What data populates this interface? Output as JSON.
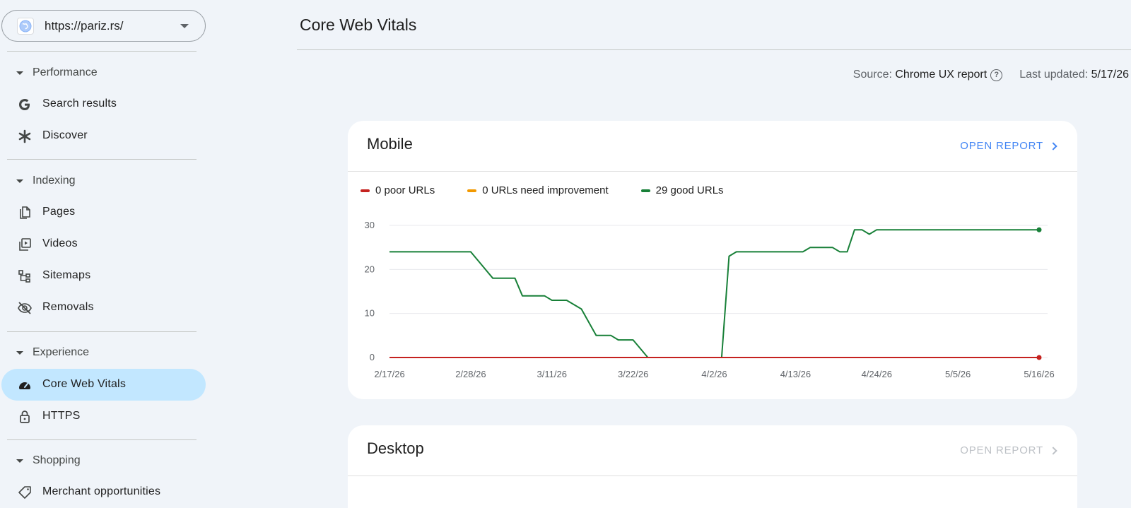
{
  "property": {
    "url": "https://pariz.rs/"
  },
  "sidebar": {
    "sections": [
      {
        "label": "Performance",
        "items": [
          {
            "label": "Search results",
            "icon": "google-g-icon"
          },
          {
            "label": "Discover",
            "icon": "asterisk-icon"
          }
        ]
      },
      {
        "label": "Indexing",
        "items": [
          {
            "label": "Pages",
            "icon": "pages-icon"
          },
          {
            "label": "Videos",
            "icon": "videos-icon"
          },
          {
            "label": "Sitemaps",
            "icon": "sitemaps-icon"
          },
          {
            "label": "Removals",
            "icon": "eye-off-icon"
          }
        ]
      },
      {
        "label": "Experience",
        "items": [
          {
            "label": "Core Web Vitals",
            "icon": "speedometer-icon",
            "active": true
          },
          {
            "label": "HTTPS",
            "icon": "lock-icon"
          }
        ]
      },
      {
        "label": "Shopping",
        "items": [
          {
            "label": "Merchant opportunities",
            "icon": "tag-icon"
          }
        ]
      }
    ]
  },
  "header": {
    "title": "Core Web Vitals"
  },
  "meta": {
    "source_label": "Source:",
    "source_value": "Chrome UX report",
    "updated_label": "Last updated:",
    "updated_value": "5/17/26"
  },
  "mobile_card": {
    "title": "Mobile",
    "open_report_label": "OPEN REPORT",
    "open_report_enabled": true
  },
  "desktop_card": {
    "title": "Desktop",
    "open_report_label": "OPEN REPORT",
    "open_report_enabled": false
  },
  "colors": {
    "poor": "#c5221f",
    "needs_improvement": "#f29900",
    "good": "#188038",
    "link": "#4285f4",
    "disabled": "#bdc1c6",
    "active_nav": "#c2e7ff"
  },
  "chart_data": {
    "type": "line",
    "title": "",
    "xlabel": "",
    "ylabel": "",
    "ylim": [
      0,
      30
    ],
    "yticks": [
      "0",
      "10",
      "20",
      "30"
    ],
    "xticks": [
      "2/17/26",
      "2/28/26",
      "3/11/26",
      "3/22/26",
      "4/2/26",
      "4/13/26",
      "4/24/26",
      "5/5/26",
      "5/16/26"
    ],
    "x": [
      "2/17/26",
      "2/28/26",
      "3/3/26",
      "3/6/26",
      "3/7/26",
      "3/10/26",
      "3/11/26",
      "3/13/26",
      "3/15/26",
      "3/17/26",
      "3/19/26",
      "3/20/26",
      "3/21/26",
      "3/22/26",
      "3/24/26",
      "3/25/26",
      "4/3/26",
      "4/4/26",
      "4/5/26",
      "4/14/26",
      "4/15/26",
      "4/18/26",
      "4/19/26",
      "4/20/26",
      "4/21/26",
      "4/22/26",
      "4/23/26",
      "4/24/26",
      "5/16/26"
    ],
    "series": [
      {
        "name": "0 poor URLs",
        "color": "#c5221f",
        "values": [
          0,
          0,
          0,
          0,
          0,
          0,
          0,
          0,
          0,
          0,
          0,
          0,
          0,
          0,
          0,
          0,
          0,
          0,
          0,
          0,
          0,
          0,
          0,
          0,
          0,
          0,
          0,
          0,
          0
        ]
      },
      {
        "name": "0 URLs need improvement",
        "color": "#f29900",
        "values": [
          0,
          0,
          0,
          0,
          0,
          0,
          0,
          0,
          0,
          0,
          0,
          0,
          0,
          0,
          0,
          0,
          0,
          0,
          0,
          0,
          0,
          0,
          0,
          0,
          0,
          0,
          0,
          0,
          0
        ]
      },
      {
        "name": "29 good URLs",
        "color": "#188038",
        "values": [
          24,
          24,
          18,
          18,
          14,
          14,
          13,
          13,
          11,
          5,
          5,
          4,
          4,
          4,
          0,
          0,
          0,
          23,
          24,
          24,
          25,
          25,
          24,
          24,
          29,
          29,
          28,
          29,
          29
        ]
      }
    ],
    "grid": true,
    "legend": "top-left"
  }
}
